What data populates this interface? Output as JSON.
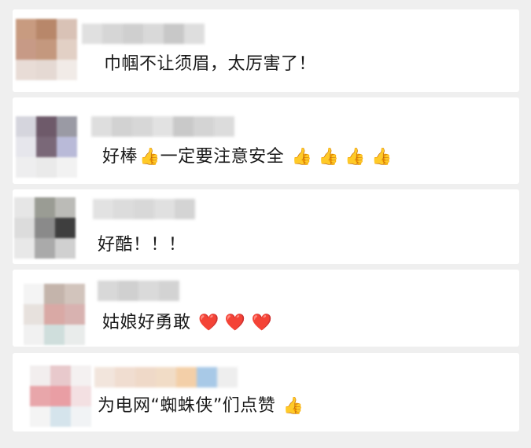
{
  "comments": [
    {
      "text": "巾帼不让须眉，太厉害了！",
      "suffix": "",
      "avatar_colors": [
        "#c89b80",
        "#b8876a",
        "#d9c2b6",
        "#c79a86",
        "#c4987e",
        "#e2d0c5",
        "#e8dcd6",
        "#e5d9d3",
        "#f1ebe7"
      ],
      "name_colors": [
        "#e0e0e0",
        "#d6d6d6",
        "#cfcfcf",
        "#d9d9d9",
        "#c8c8c8",
        "#dedede"
      ]
    },
    {
      "text": "好棒",
      "emoji1": "👍",
      "text2": "一定要注意安全",
      "suffix": "👍 👍 👍 👍",
      "avatar_colors": [
        "#d5d5dd",
        "#6e5a6a",
        "#9a9aa4",
        "#e6e6ec",
        "#7a6878",
        "#b9bad8",
        "#eeeeef",
        "#eaeaea",
        "#f2f2f2"
      ],
      "name_colors": [
        "#dedede",
        "#d2d2d2",
        "#d7d7d7",
        "#e2e2e2",
        "#c9c9c9",
        "#d4d4d4",
        "#dcdcdc"
      ]
    },
    {
      "text": "好酷！！！",
      "suffix": "",
      "avatar_colors": [
        "#e6e6e6",
        "#9a9c94",
        "#bbbbb7",
        "#dcdcdc",
        "#8a8a8a",
        "#3e3e3e",
        "#e8e8e8",
        "#aaaaaa",
        "#d0d0d0"
      ],
      "name_colors": [
        "#e2e2e2",
        "#dcdcdc",
        "#d8d8d8",
        "#e0e0e0",
        "#d4d4d4"
      ]
    },
    {
      "text": "姑娘好勇敢",
      "suffix": "❤️ ❤️ ❤️",
      "avatar_colors": [
        "#f4f4f4",
        "#c4b4ab",
        "#d2c4bc",
        "#e7e1dd",
        "#d9a9a5",
        "#d8b2b0",
        "#f1f1f1",
        "#cfdedc",
        "#e9eceb"
      ],
      "name_colors": [
        "#d8d8d8",
        "#d0d0d0",
        "#dadada",
        "#d3d3d3"
      ]
    },
    {
      "text": "为电网“蜘蛛侠”们点赞",
      "suffix": "👍",
      "avatar_colors": [
        "#f2eeee",
        "#e8c9cc",
        "#f4f1f1",
        "#e8a6aa",
        "#e99ea4",
        "#f3e0e2",
        "#f4f4f4",
        "#d5e4ec",
        "#f1f3f5"
      ],
      "name_colors": [
        "#f2e5dc",
        "#f0ddd0",
        "#efd9c8",
        "#f1dcc6",
        "#f3cfa8",
        "#a8c9e7",
        "#eeeeee"
      ]
    }
  ]
}
